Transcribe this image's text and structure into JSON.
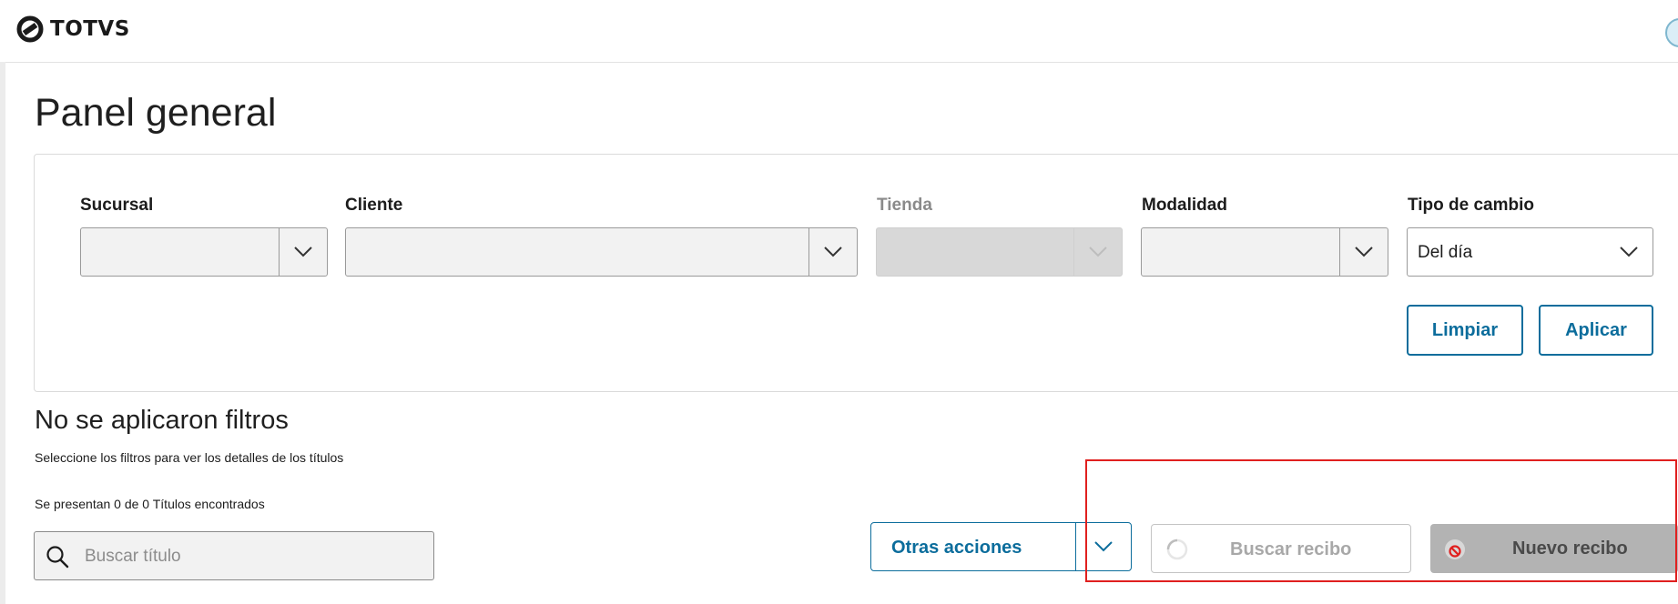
{
  "brand": {
    "name": "TOTVS"
  },
  "page": {
    "title": "Panel general"
  },
  "filters": {
    "sucursal": {
      "label": "Sucursal",
      "value": ""
    },
    "cliente": {
      "label": "Cliente",
      "value": ""
    },
    "tienda": {
      "label": "Tienda",
      "value": "",
      "disabled": true
    },
    "modalidad": {
      "label": "Modalidad",
      "value": ""
    },
    "tipo_cambio": {
      "label": "Tipo de cambio",
      "value": "Del día"
    },
    "clear_label": "Limpiar",
    "apply_label": "Aplicar"
  },
  "status": {
    "title": "No se aplicaron filtros",
    "subtitle": "Seleccione los filtros para ver los detalles de los títulos",
    "count_text": "Se presentan 0 de 0 Títulos encontrados"
  },
  "search": {
    "placeholder": "Buscar título"
  },
  "actions": {
    "other_label": "Otras acciones",
    "search_receipt_label": "Buscar recibo",
    "new_receipt_label": "Nuevo recibo"
  },
  "colors": {
    "accent": "#0c6d9c",
    "highlight": "#e0201f",
    "disabled_button": "#b3b3b3"
  },
  "icons": [
    "totvs-logo-icon",
    "chevron-down-icon",
    "search-icon",
    "loading-spinner-icon",
    "not-allowed-icon"
  ]
}
